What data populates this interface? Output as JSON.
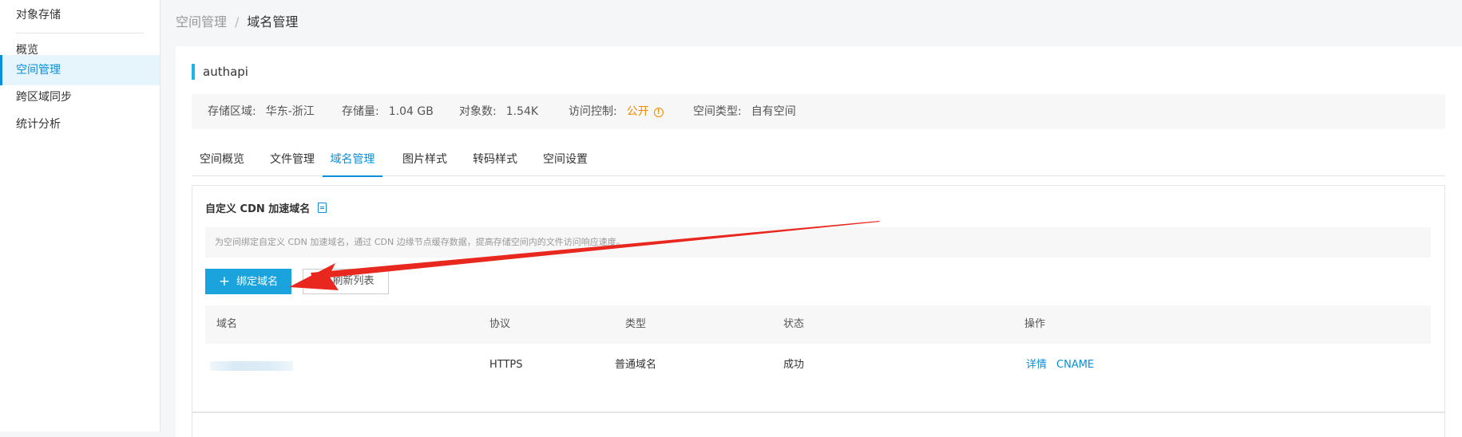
{
  "sidebar": {
    "title": "对象存储",
    "items": [
      {
        "label": "概览"
      },
      {
        "label": "空间管理"
      },
      {
        "label": "跨区域同步"
      },
      {
        "label": "统计分析"
      }
    ]
  },
  "breadcrumb": {
    "parent": "空间管理",
    "separator": "/",
    "current": "域名管理"
  },
  "bucket": {
    "name": "authapi",
    "info": {
      "region_label": "存储区域:",
      "region_value": "华东-浙江",
      "storage_label": "存储量:",
      "storage_value": "1.04 GB",
      "objects_label": "对象数:",
      "objects_value": "1.54K",
      "access_label": "访问控制:",
      "access_value": "公开",
      "type_label": "空间类型:",
      "type_value": "自有空间"
    }
  },
  "tabs": [
    {
      "label": "空间概览"
    },
    {
      "label": "文件管理"
    },
    {
      "label": "域名管理"
    },
    {
      "label": "图片样式"
    },
    {
      "label": "转码样式"
    },
    {
      "label": "空间设置"
    }
  ],
  "panel": {
    "title": "自定义 CDN 加速域名",
    "description": "为空间绑定自定义 CDN 加速域名，通过 CDN 边缘节点缓存数据，提高存储空间内的文件访问响应速度。",
    "bind_button": "绑定域名",
    "refresh_button": "刷新列表",
    "table": {
      "columns": [
        "域名",
        "协议",
        "类型",
        "状态",
        "操作"
      ],
      "rows": [
        {
          "domain": "",
          "protocol": "HTTPS",
          "type": "普通域名",
          "status": "成功",
          "actions": [
            "详情",
            "CNAME"
          ]
        }
      ]
    }
  },
  "colors": {
    "accent": "#0a8fd8",
    "primary_button": "#1aa3dc",
    "warning": "#f08a00",
    "annotation_arrow": "#e8281f"
  }
}
